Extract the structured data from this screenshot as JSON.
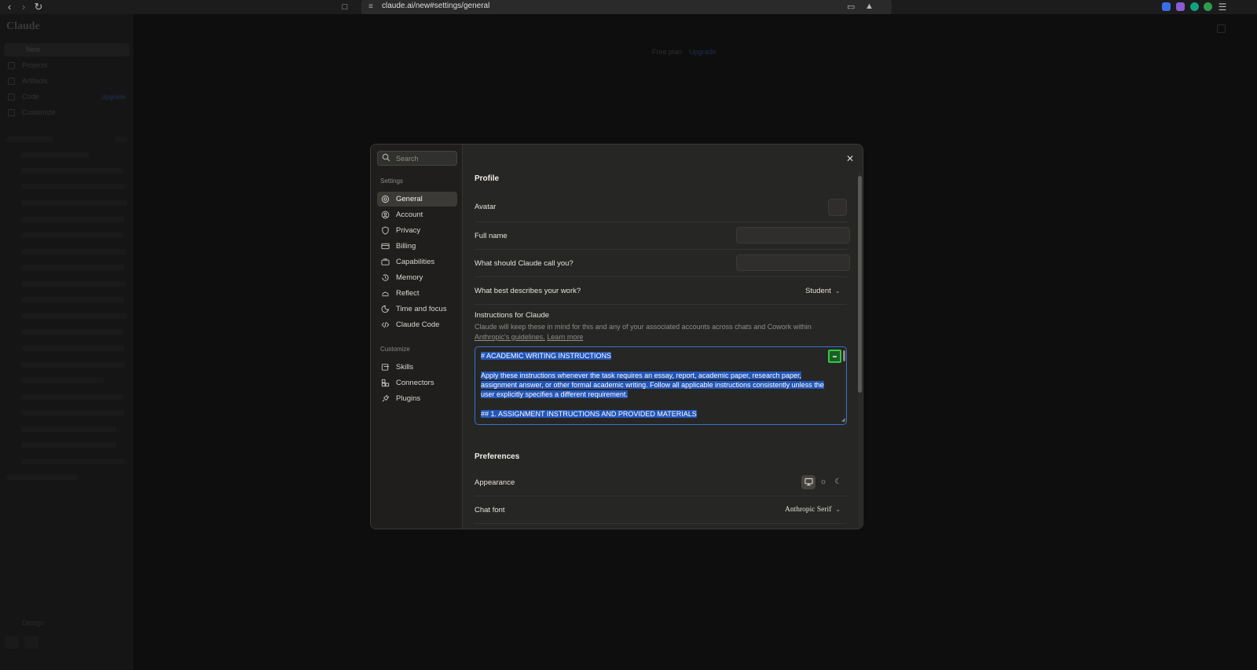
{
  "browser": {
    "url": "claude.ai/new#settings/general",
    "icons": [
      "back-icon",
      "forward-icon",
      "reload-icon",
      "bookmark-icon",
      "site-settings-icon",
      "cast-icon",
      "brave-shield-icon",
      "extensions-icon",
      "menu-icon"
    ]
  },
  "background_app": {
    "logo": "Claude",
    "new_label": "New",
    "nav": [
      "Projects",
      "Artifacts",
      "Code",
      "Customize"
    ],
    "code_upgrade": "Upgrade",
    "plan": "Free plan",
    "plan_upgrade": "Upgrade",
    "design_label": "Design"
  },
  "modal": {
    "search_placeholder": "Search",
    "settings_header": "Settings",
    "settings_items": [
      {
        "label": "General",
        "icon": "gear-icon",
        "active": true
      },
      {
        "label": "Account",
        "icon": "user-circle-icon"
      },
      {
        "label": "Privacy",
        "icon": "shield-icon"
      },
      {
        "label": "Billing",
        "icon": "credit-card-icon"
      },
      {
        "label": "Capabilities",
        "icon": "briefcase-icon"
      },
      {
        "label": "Memory",
        "icon": "history-icon"
      },
      {
        "label": "Reflect",
        "icon": "reflect-icon"
      },
      {
        "label": "Time and focus",
        "icon": "moon-icon"
      },
      {
        "label": "Claude Code",
        "icon": "code-icon"
      }
    ],
    "customize_header": "Customize",
    "customize_items": [
      {
        "label": "Skills",
        "icon": "skills-icon"
      },
      {
        "label": "Connectors",
        "icon": "connectors-icon"
      },
      {
        "label": "Plugins",
        "icon": "plug-icon"
      }
    ],
    "profile": {
      "title": "Profile",
      "avatar_label": "Avatar",
      "full_name_label": "Full name",
      "full_name_value": "",
      "nickname_label": "What should Claude call you?",
      "nickname_value": "",
      "work_label": "What best describes your work?",
      "work_value": "Student",
      "instructions_label": "Instructions for Claude",
      "instructions_help": "Claude will keep these in mind for this and any of your associated accounts across chats and Cowork within",
      "instructions_help_link1": "Anthropic's guidelines.",
      "instructions_help_link2": "Learn more",
      "instructions_lines": [
        "# ACADEMIC WRITING INSTRUCTIONS",
        "",
        "Apply these instructions whenever the task requires an essay, report, academic paper, research paper,",
        "assignment answer, or other formal academic writing. Follow all applicable instructions consistently unless the",
        "user explicitly specifies a different requirement.",
        "",
        "## 1. ASSIGNMENT INSTRUCTIONS AND PROVIDED MATERIALS"
      ]
    },
    "preferences": {
      "title": "Preferences",
      "appearance_label": "Appearance",
      "appearance_options": [
        "system",
        "light",
        "dark"
      ],
      "appearance_selected": "system",
      "chat_font_label": "Chat font",
      "chat_font_value": "Anthropic Serif"
    }
  },
  "colors": {
    "accent_selection": "#2356b8",
    "focus_border": "#3b6fcf",
    "modal_bg": "#262624"
  }
}
